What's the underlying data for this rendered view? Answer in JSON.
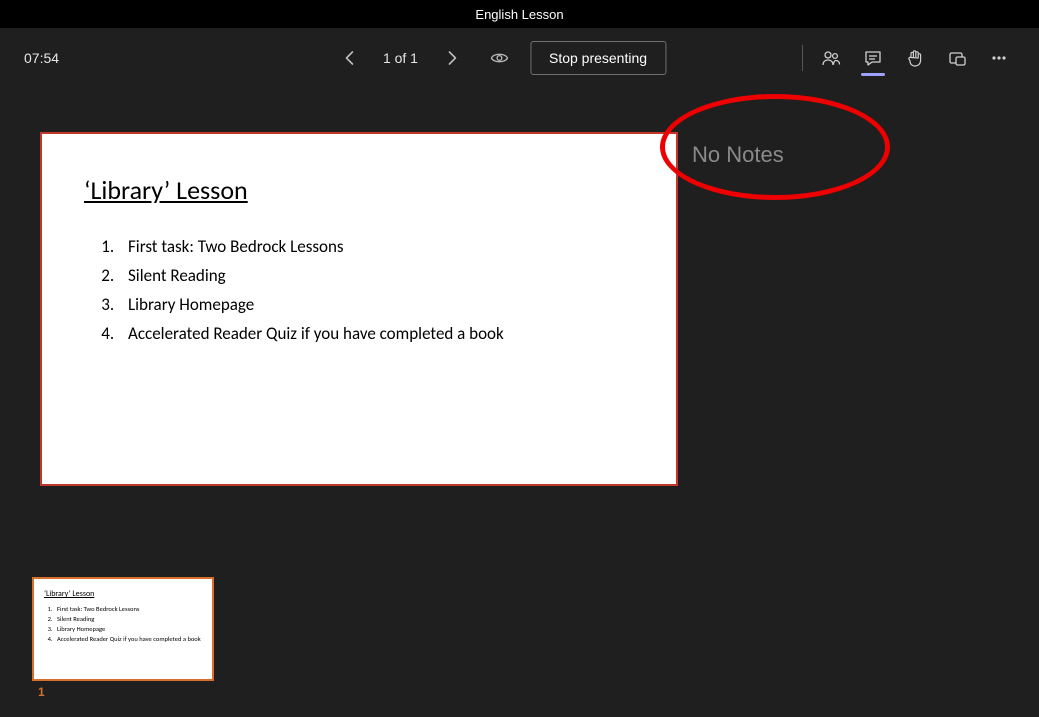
{
  "titlebar": {
    "title": "English Lesson"
  },
  "toolbar": {
    "time": "07:54",
    "page_indicator": "1 of 1",
    "stop_label": "Stop presenting"
  },
  "slide": {
    "title": "‘Library’ Lesson",
    "items": {
      "0": "First task: Two Bedrock Lessons",
      "1": "Silent Reading",
      "2": "Library Homepage",
      "3": "Accelerated Reader Quiz if you have completed a book"
    }
  },
  "notes": {
    "label": "No Notes"
  },
  "thumb": {
    "title": "‘Library’ Lesson",
    "items": {
      "0": "First task: Two Bedrock Lessons",
      "1": "Silent Reading",
      "2": "Library Homepage",
      "3": "Accelerated Reader Quiz if you have completed a book"
    },
    "number": "1"
  }
}
